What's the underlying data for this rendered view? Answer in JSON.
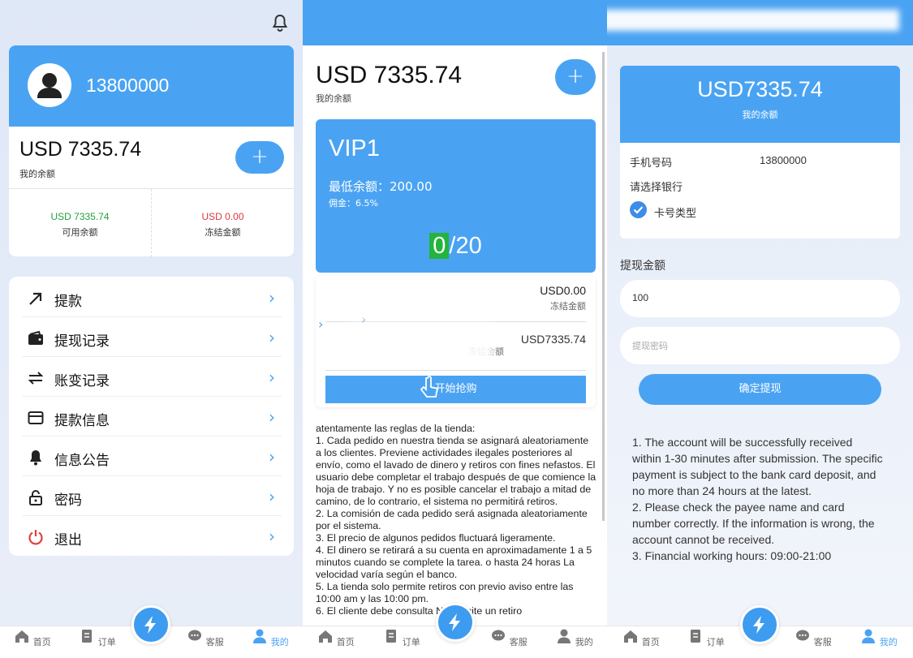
{
  "colors": {
    "accent": "#4aa3f2",
    "green": "#22a03a",
    "red": "#d93a3a"
  },
  "profile": {
    "phone": "13800000",
    "balance": "USD 7335.74",
    "balance_label": "我的余额",
    "add_label": "+",
    "available_value": "USD 7335.74",
    "available_label": "可用余额",
    "frozen_value": "USD 0.00",
    "frozen_label": "冻结金额"
  },
  "menu": [
    {
      "label": "提款",
      "icon": "arrow-up-right-icon"
    },
    {
      "label": "提现记录",
      "icon": "wallet-icon"
    },
    {
      "label": "账变记录",
      "icon": "swap-icon"
    },
    {
      "label": "提款信息",
      "icon": "card-icon"
    },
    {
      "label": "信息公告",
      "icon": "bell-icon"
    },
    {
      "label": "密码",
      "icon": "lock-icon"
    },
    {
      "label": "退出",
      "icon": "power-icon"
    }
  ],
  "tabbar": {
    "home": "首页",
    "orders": "订单",
    "service": "客服",
    "mine": "我的"
  },
  "grab": {
    "balance": "USD 7335.74",
    "balance_label": "我的余额",
    "add_label": "+",
    "vip_name": "VIP1",
    "min_balance": "最低余额：200.00",
    "commission": "佣金：6.5%",
    "progress_current": "0",
    "progress_total": "/20",
    "frozen_value": "USD0.00",
    "frozen_label": "冻结金额",
    "frozen_label_2": "冻结金额",
    "available_value": "USD7335.74",
    "start_button": "开始抢购",
    "rules": "atentamente las reglas de la tienda:\n1. Cada pedido en nuestra tienda se asignará aleatoriamente a los clientes. Previene actividades ilegales posteriores al envío, como el lavado de dinero y retiros con fines nefastos. El usuario debe completar el trabajo después de que comience la hoja de trabajo. Y no es posible cancelar el trabajo a mitad de camino, de lo contrario, el sistema no permitirá retiros.\n2. La comisión de cada pedido será asignada aleatoriamente por el sistema.\n3. El precio de algunos pedidos fluctuará ligeramente.\n4. El dinero se retirará a su cuenta en aproximadamente 1 a 5 minutos cuando se complete la tarea. o hasta 24 horas La velocidad varía según el banco.\n5. La tienda solo permite retiros con previo aviso entre las 10:00 am y las 10:00 pm.\n6. El cliente debe consulta        No solicite un retiro"
  },
  "withdraw": {
    "balance": "USD7335.74",
    "balance_label": "我的余额",
    "phone_label": "手机号码",
    "phone_value": "13800000",
    "bank_label": "请选择银行",
    "card_type": "卡号类型",
    "amount_title": "提现金额",
    "amount_value": "100",
    "password_placeholder": "提现密码",
    "confirm": "确定提现",
    "notes": "1. The account will be successfully received within 1-30 minutes after submission. The specific payment is subject to the bank card deposit, and no more than 24 hours at the latest.\n2. Please check the payee name and card number correctly. If the information is wrong, the account cannot be received.\n3. Financial working hours: 09:00-21:00"
  }
}
